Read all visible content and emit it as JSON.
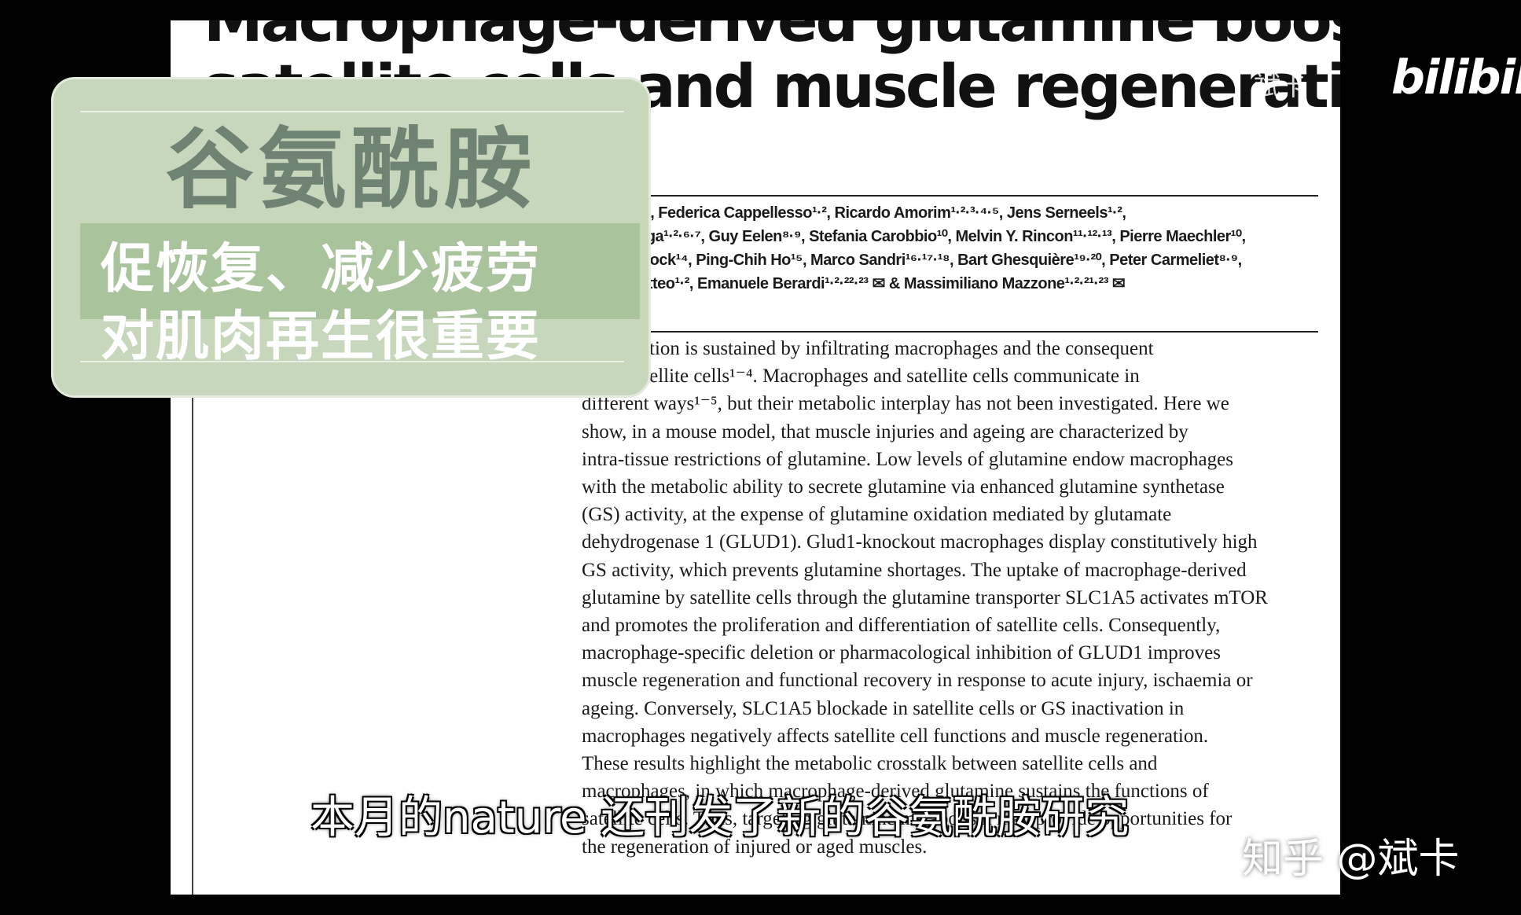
{
  "paper": {
    "title_lines": [
      "Macrophage-derived glutamine boosts",
      "satellite cells and muscle regeneration"
    ],
    "authors_lines": [
      "g¹·², Federica Cappellesso¹·², Ricardo Amorim¹·²·³·⁴·⁵, Jens Serneels¹·²,",
      "Virga¹·²·⁶·⁷, Guy Eelen⁸·⁹, Stefania Carobbio¹⁰, Melvin Y. Rincon¹¹·¹²·¹³, Pierre Maechler¹⁰,",
      "e Bock¹⁴, Ping-Chih Ho¹⁵, Marco Sandri¹⁶·¹⁷·¹⁸, Bart Ghesquière¹⁹·²⁰, Peter Carmeliet⁸·⁹,",
      "Matteo¹·², Emanuele Berardi¹·²·²²·²³ ✉ & Massimiliano Mazzone¹·²·²¹·²³ ✉"
    ],
    "abstract_lines": [
      "regeneration is sustained by infiltrating macrophages and the consequent",
      "on of satellite cells¹⁻⁴. Macrophages and satellite cells communicate in",
      "different ways¹⁻⁵, but their metabolic interplay has not been investigated. Here we",
      "show, in a mouse model, that muscle injuries and ageing are characterized by",
      "intra-tissue restrictions of glutamine. Low levels of glutamine endow macrophages",
      "with the metabolic ability to secrete glutamine via enhanced glutamine synthetase",
      "(GS) activity, at the expense of glutamine oxidation mediated by glutamate",
      "dehydrogenase 1 (GLUD1). Glud1-knockout macrophages display constitutively high",
      "GS activity, which prevents glutamine shortages. The uptake of macrophage-derived",
      "glutamine by satellite cells through the glutamine transporter SLC1A5 activates mTOR",
      "and promotes the proliferation and differentiation of satellite cells. Consequently,",
      "macrophage-specific deletion or pharmacological inhibition of GLUD1 improves",
      "muscle regeneration and functional recovery in response to acute injury, ischaemia or",
      "ageing. Conversely, SLC1A5 blockade in satellite cells or GS inactivation in",
      "macrophages negatively affects satellite cell functions and muscle regeneration.",
      "These results highlight the metabolic crosstalk between satellite cells and",
      "macrophages, in which macrophage-derived glutamine sustains the functions of",
      "satellite cells. Thus, targeting glutamine metabolism may provide opportunities for",
      "the regeneration of injured or aged muscles."
    ]
  },
  "badge": {
    "title": "谷氨酰胺",
    "subtitle_line1": "促恢复、减少疲劳",
    "subtitle_line2": "对肌肉再生很重要"
  },
  "overlay": {
    "caption": "本月的nature 还刊发了新的谷氨酰胺研究",
    "watermark": "知乎 @斌卡",
    "logo_text": "bilibili",
    "logo_user": "斌卡"
  },
  "colors": {
    "badge_bg": "#c6d7bc",
    "badge_dark": "#a9c39d",
    "badge_title": "#6f8372"
  }
}
